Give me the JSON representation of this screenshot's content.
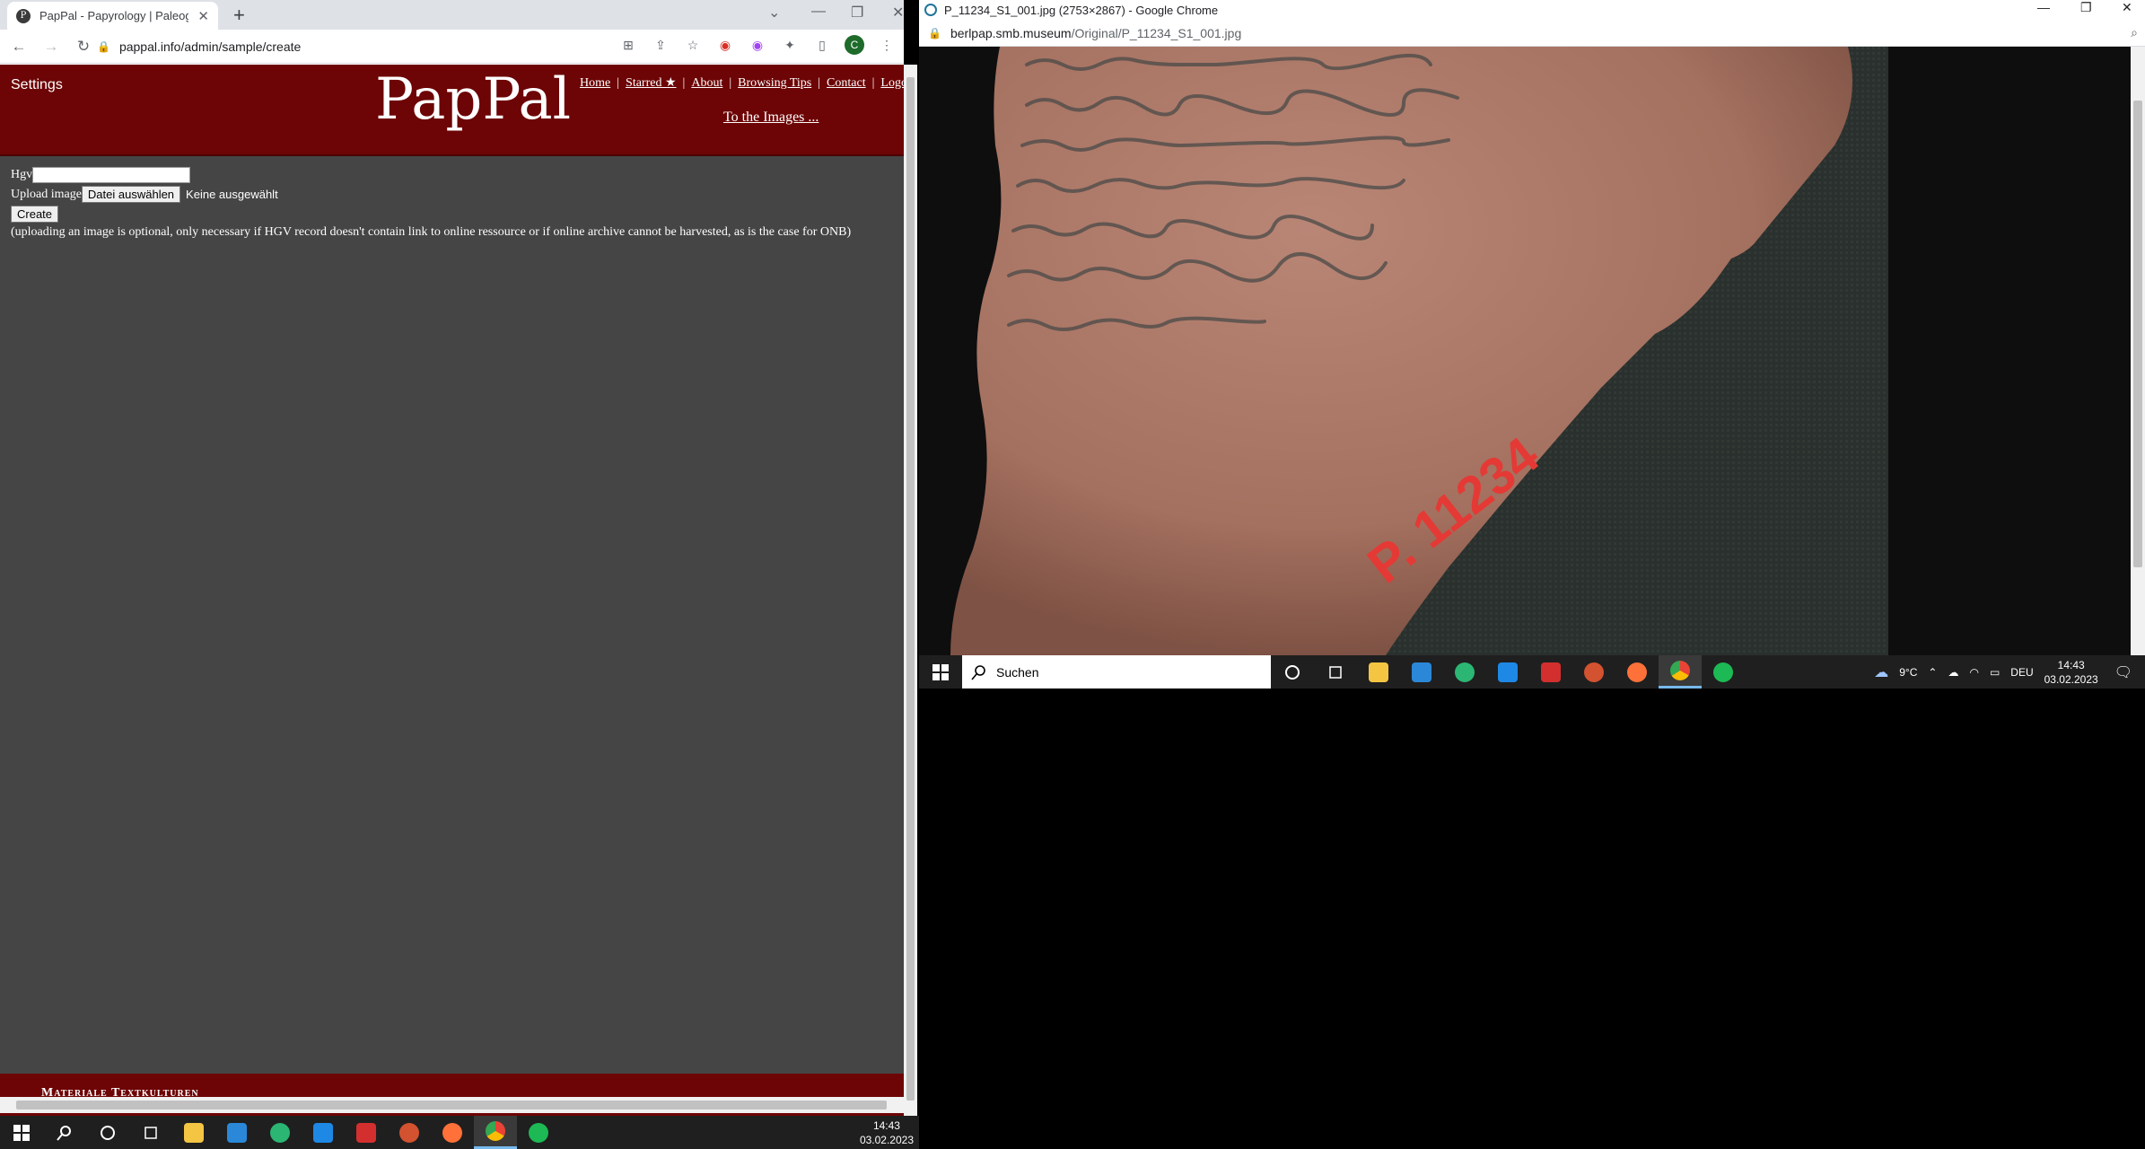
{
  "left_browser": {
    "tab_title": "PapPal - Papyrology | Paleograph",
    "url": "pappal.info/admin/sample/create",
    "profile_initial": "C"
  },
  "pappal": {
    "settings_label": "Settings",
    "logo": "PapPal",
    "nav": [
      "Home",
      "Starred ★",
      "About",
      "Browsing Tips",
      "Contact",
      "Logou"
    ],
    "to_images": "To the Images ...",
    "hgv_label": "Hgv",
    "upload_label": "Upload image",
    "file_button": "Datei auswählen",
    "file_status": "Keine ausgewählt",
    "create_button": "Create",
    "note": "(uploading an image is optional, only necessary if HGV record doesn't contain link to online ressource or if online archive cannot be harvested, as is the case for ONB)",
    "footer_text": "Materiale Textkulturen"
  },
  "right_browser": {
    "window_title": "P_11234_S1_001.jpg (2753×2867) - Google Chrome",
    "url_host": "berlpap.smb.museum",
    "url_path": "/Original/P_11234_S1_001.jpg",
    "ostracon_label": "P. 11234"
  },
  "taskbar_right": {
    "search_placeholder": "Suchen",
    "weather": "9°C",
    "language": "DEU",
    "time": "14:43",
    "date": "03.02.2023"
  },
  "taskbar_left": {
    "time": "14:43",
    "date": "03.02.2023"
  },
  "colors": {
    "pappal_red": "#6d0405",
    "page_bg": "#454545",
    "taskbar": "#1f1f1f"
  }
}
